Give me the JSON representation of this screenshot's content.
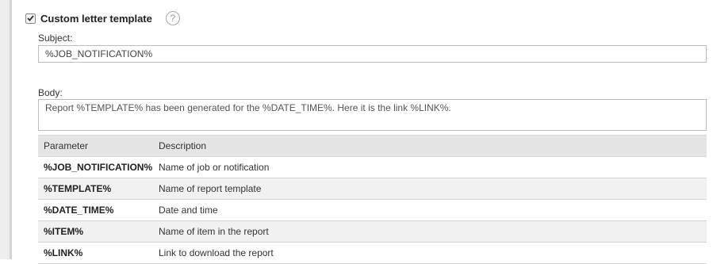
{
  "section": {
    "checkbox_label": "Custom letter template",
    "checked": true,
    "help_icon": "question-circle-icon",
    "help_glyph": "?"
  },
  "subject": {
    "label": "Subject:",
    "value": "%JOB_NOTIFICATION%"
  },
  "body": {
    "label": "Body:",
    "value": "Report %TEMPLATE% has been generated for the %DATE_TIME%. Here it is the link %LINK%."
  },
  "params_table": {
    "headers": [
      "Parameter",
      "Description"
    ],
    "rows": [
      {
        "parameter": "%JOB_NOTIFICATION%",
        "description": "Name of job or notification"
      },
      {
        "parameter": "%TEMPLATE%",
        "description": "Name of report template"
      },
      {
        "parameter": "%DATE_TIME%",
        "description": "Date and time"
      },
      {
        "parameter": "%ITEM%",
        "description": "Name of item in the report"
      },
      {
        "parameter": "%LINK%",
        "description": "Link to download the report"
      }
    ]
  },
  "colors": {
    "header_bg": "#e5e5e5",
    "row_alt_bg": "#f1f1f1",
    "border": "#bdbdbd"
  }
}
